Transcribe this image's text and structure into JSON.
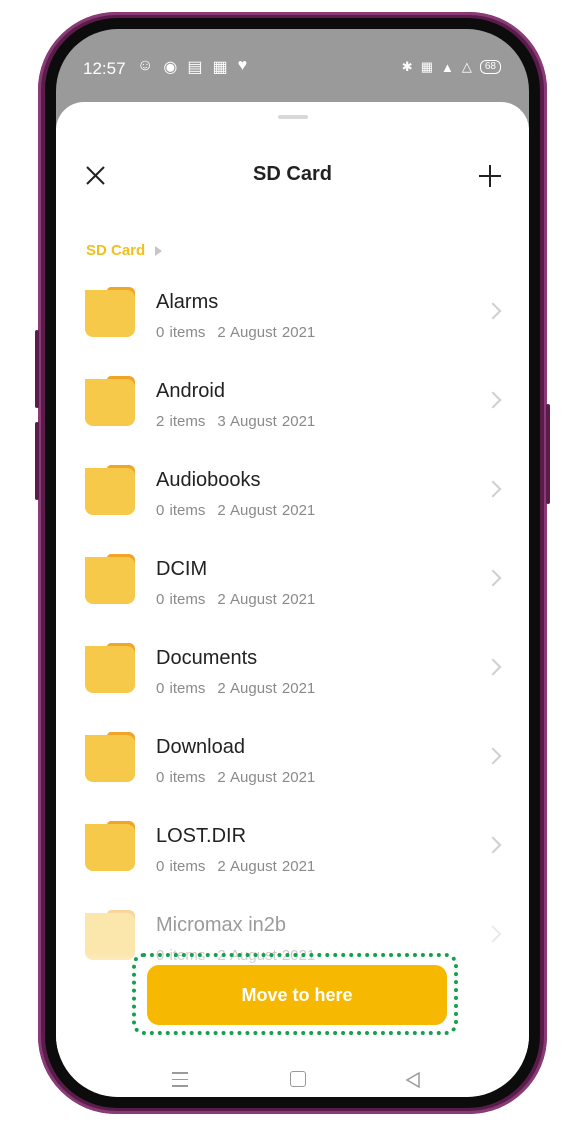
{
  "status_bar": {
    "time": "12:57",
    "left_icons": [
      "account-icon",
      "record-icon",
      "sim-icon",
      "sim2-icon",
      "heart-icon"
    ],
    "right_icons": [
      "bluetooth-icon",
      "volte-icon",
      "4g-signal-icon",
      "signal-icon"
    ],
    "battery": "68"
  },
  "header": {
    "title": "SD Card"
  },
  "breadcrumb": {
    "items": [
      "SD Card"
    ]
  },
  "folders": [
    {
      "name": "Alarms",
      "items": "0 items",
      "date": "2 August 2021"
    },
    {
      "name": "Android",
      "items": "2 items",
      "date": "3 August 2021"
    },
    {
      "name": "Audiobooks",
      "items": "0 items",
      "date": "2 August 2021"
    },
    {
      "name": "DCIM",
      "items": "0 items",
      "date": "2 August 2021"
    },
    {
      "name": "Documents",
      "items": "0 items",
      "date": "2 August 2021"
    },
    {
      "name": "Download",
      "items": "0 items",
      "date": "2 August 2021"
    },
    {
      "name": "LOST.DIR",
      "items": "0 items",
      "date": "2 August 2021"
    },
    {
      "name": "Micromax in2b",
      "items": "0 items",
      "date": "2 August 2021"
    }
  ],
  "action": {
    "move_label": "Move to here"
  },
  "colors": {
    "accent": "#f6b800",
    "breadcrumb": "#f3bf1e",
    "folder": "#f7c94a",
    "folder_tab": "#f0a526",
    "highlight": "#14a14b"
  }
}
